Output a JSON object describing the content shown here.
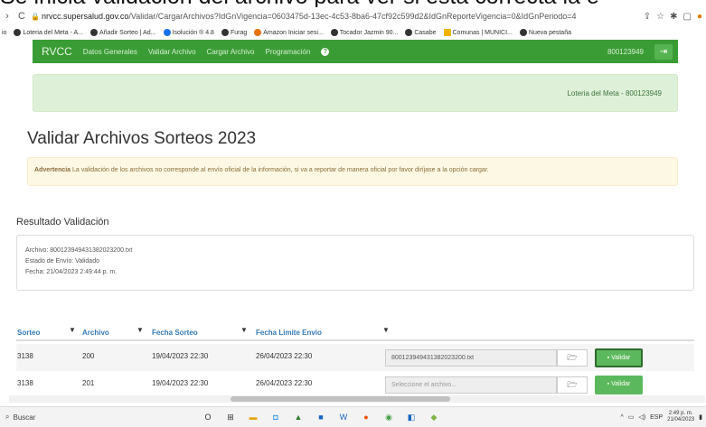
{
  "caption": "Se inicia validación del archivo para ver si esta correcta la e",
  "browser": {
    "url_prefix": "nrvcc.supersalud.gov.co",
    "url_path": "/Validar/CargarArchivos?IdGnVigencia=0603475d-13ec-4c53-8ba6-47cf92c599d2&IdGnReporteVigencia=0&IdGnPeriodo=4",
    "bookmarks": [
      "Loteria del Meta - A...",
      "Añadir Sorteo | Ad...",
      "Isolución ® 4.8",
      "Furag",
      "Amazon Iniciar sesi...",
      "Tocador Jazmin 90...",
      "Casabe",
      "Comunas | MUNICI...",
      "Nueva pestaña"
    ]
  },
  "navbar": {
    "brand": "RVCC",
    "links": [
      "Datos Generales",
      "Validar Archivo",
      "Cargar Archivo",
      "Programación"
    ],
    "entity_id": "800123949"
  },
  "banner": {
    "entity": "Loteria del Meta - 800123949"
  },
  "page": {
    "title": "Validar Archivos Sorteos 2023",
    "warning_label": "Advertencia",
    "warning_text": " La validación de los archivos no corresponde al envío oficial de la información, si va a reportar de manera oficial por favor diríjase a la opción cargar."
  },
  "result": {
    "heading": "Resultado Validación",
    "archivo": "Archivo: 80012394943138202320​0.txt",
    "estado": "Estado de Envío: Validado",
    "fecha": "Fecha: 21/04/2023 2:49:44 p. m."
  },
  "table": {
    "headers": [
      "Sorteo",
      "Archivo",
      "Fecha Sorteo",
      "Fecha Limite Envio"
    ],
    "rows": [
      {
        "sorteo": "3138",
        "archivo": "200",
        "fecha_sorteo": "19/04/2023 22:30",
        "fecha_limite": "26/04/2023 22:30",
        "file": "800123949431382023200.txt",
        "button": "Validar"
      },
      {
        "sorteo": "3138",
        "archivo": "201",
        "fecha_sorteo": "19/04/2023 22:30",
        "fecha_limite": "26/04/2023 22:30",
        "file": "Seleccione el archivo...",
        "button": "Validar"
      }
    ]
  },
  "taskbar": {
    "search": "Buscar",
    "lang": "ESP",
    "time": "2:49 p. m.",
    "date": "21/04/2023"
  }
}
